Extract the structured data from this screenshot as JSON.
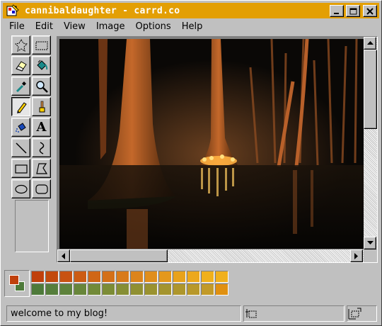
{
  "window": {
    "title": "cannibaldaughter - carrd.co",
    "controls": {
      "minimize": "minimize-icon",
      "maximize": "maximize-icon",
      "close": "close-icon"
    }
  },
  "menu": [
    {
      "label": "File"
    },
    {
      "label": "Edit"
    },
    {
      "label": "View"
    },
    {
      "label": "Image"
    },
    {
      "label": "Options"
    },
    {
      "label": "Help"
    }
  ],
  "tools": [
    {
      "icon": "free-select-icon"
    },
    {
      "icon": "rect-select-icon"
    },
    {
      "icon": "eraser-icon"
    },
    {
      "icon": "fill-bucket-icon"
    },
    {
      "icon": "eyedropper-icon"
    },
    {
      "icon": "magnifier-icon"
    },
    {
      "icon": "pencil-icon",
      "selected": true
    },
    {
      "icon": "brush-icon"
    },
    {
      "icon": "airbrush-icon"
    },
    {
      "icon": "text-icon",
      "glyph": "A"
    },
    {
      "icon": "line-icon"
    },
    {
      "icon": "curve-icon"
    },
    {
      "icon": "rectangle-icon"
    },
    {
      "icon": "polygon-icon"
    },
    {
      "icon": "ellipse-icon"
    },
    {
      "icon": "rounded-rect-icon"
    }
  ],
  "canvas": {
    "image_description": "night swamp forest with lit cypress tree"
  },
  "palette": {
    "foreground": "#c0400c",
    "background": "#4e7a3a",
    "row1": [
      "#c0400c",
      "#c24a0e",
      "#c85212",
      "#cc5c14",
      "#d06616",
      "#d47018",
      "#d87a1a",
      "#dc841c",
      "#e08e1c",
      "#e4981c",
      "#e8a21c",
      "#eca81c",
      "#f0b01c",
      "#f0b01c"
    ],
    "row2": [
      "#4e7a3a",
      "#567e3c",
      "#5e823c",
      "#68863a",
      "#728a38",
      "#7c8c36",
      "#868e34",
      "#909032",
      "#9a9230",
      "#a4942e",
      "#ae962c",
      "#b8982a",
      "#c29a28",
      "#e09010"
    ]
  },
  "status": {
    "message": "welcome to my blog!",
    "position_icon": "cursor-position-icon",
    "size_icon": "selection-size-icon"
  }
}
